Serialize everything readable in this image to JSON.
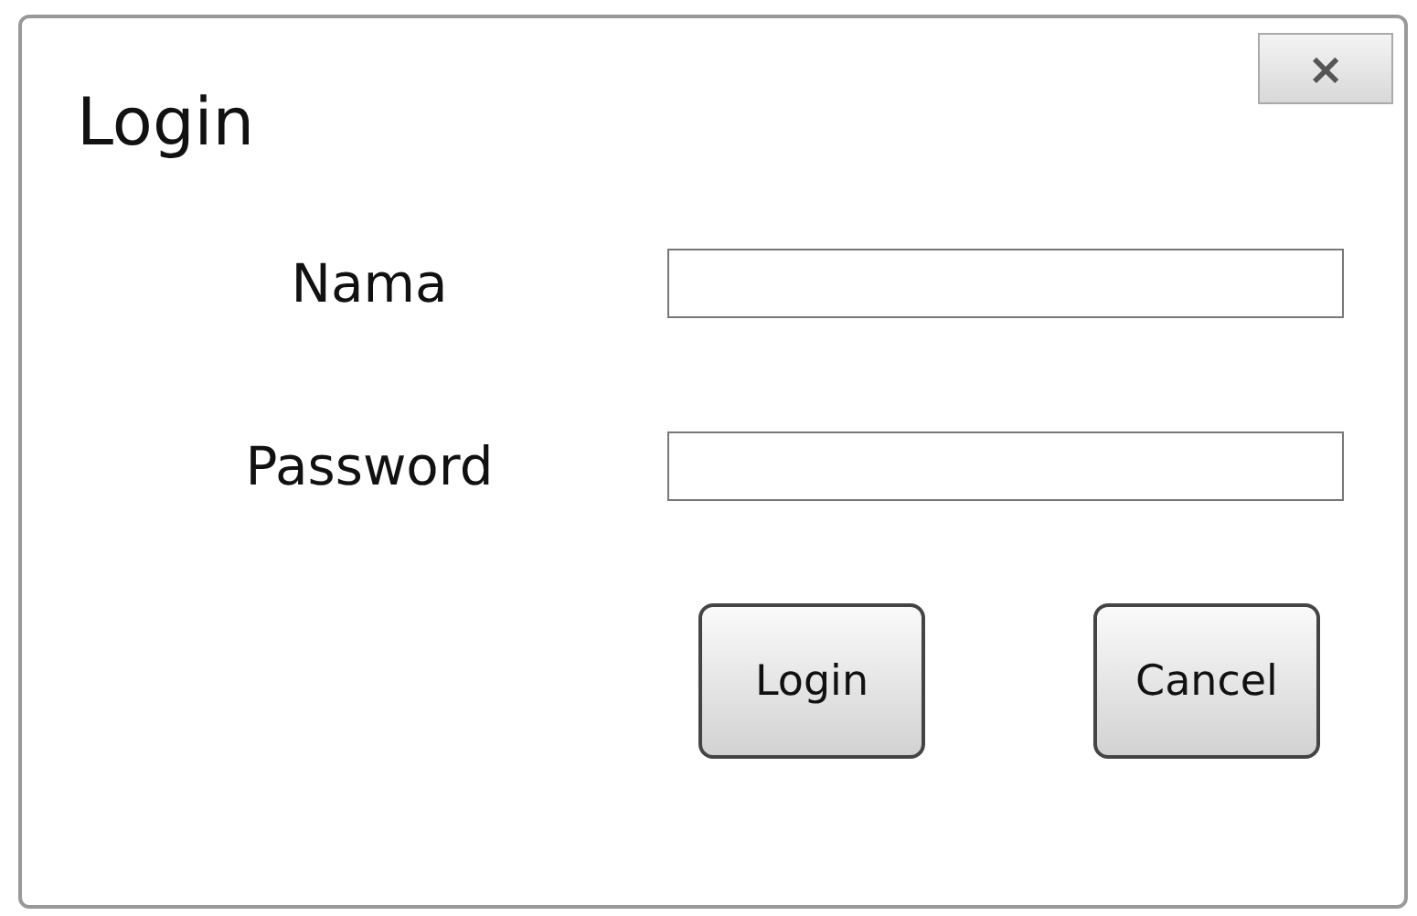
{
  "window": {
    "title": "Login",
    "close_icon": "×"
  },
  "fields": [
    {
      "label": "Nama"
    },
    {
      "label": "Password"
    }
  ],
  "buttons": [
    {
      "label": "Login"
    },
    {
      "label": "Cancel"
    }
  ]
}
